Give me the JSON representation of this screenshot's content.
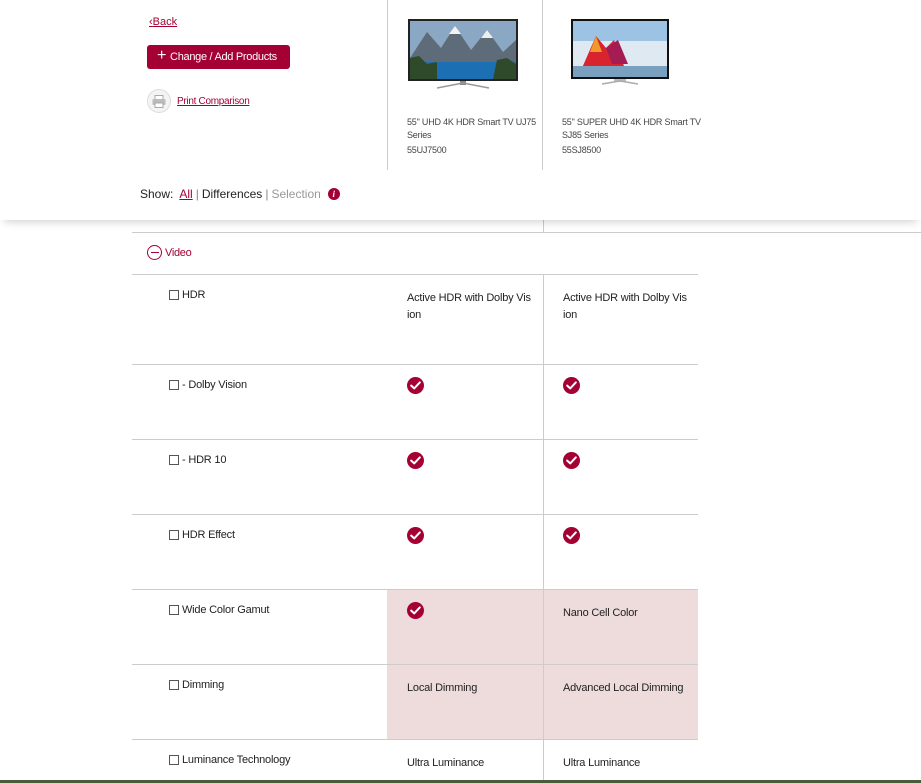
{
  "header": {
    "back_label": "Back",
    "change_label": "Change / Add Products",
    "print_label": "Print Comparison"
  },
  "products": [
    {
      "name": "55\" UHD 4K HDR Smart TV UJ75 Series",
      "model": "55UJ7500"
    },
    {
      "name": "55\" SUPER UHD 4K HDR Smart TV SJ85 Series",
      "model": "55SJ8500"
    }
  ],
  "show": {
    "label": "Show:",
    "all": "All",
    "differences": "Differences",
    "selection": "Selection",
    "separator": "|"
  },
  "section": {
    "title": "Video"
  },
  "rows": [
    {
      "label": "HDR",
      "a": {
        "type": "text",
        "text": "Active HDR with Dolby Vision"
      },
      "b": {
        "type": "text",
        "text": "Active HDR with Dolby Vision"
      },
      "highlight": false
    },
    {
      "label": "- Dolby Vision",
      "a": {
        "type": "check",
        "text": ""
      },
      "b": {
        "type": "check",
        "text": ""
      },
      "highlight": false
    },
    {
      "label": "- HDR 10",
      "a": {
        "type": "check",
        "text": ""
      },
      "b": {
        "type": "check",
        "text": ""
      },
      "highlight": false
    },
    {
      "label": "HDR Effect",
      "a": {
        "type": "check",
        "text": ""
      },
      "b": {
        "type": "check",
        "text": ""
      },
      "highlight": false
    },
    {
      "label": "Wide Color Gamut",
      "a": {
        "type": "check",
        "text": ""
      },
      "b": {
        "type": "text",
        "text": "Nano Cell Color"
      },
      "highlight": true
    },
    {
      "label": "Dimming",
      "a": {
        "type": "text",
        "text": "Local Dimming"
      },
      "b": {
        "type": "text",
        "text": "Advanced Local Dimming"
      },
      "highlight": true
    },
    {
      "label": "Luminance Technology",
      "a": {
        "type": "text",
        "text": "Ultra Luminance"
      },
      "b": {
        "type": "text",
        "text": "Ultra Luminance"
      },
      "highlight": false
    }
  ],
  "colors": {
    "accent": "#a50034",
    "highlight": "#eedcdc"
  },
  "icons": [
    "plus-icon",
    "printer-icon",
    "info-icon",
    "minus-circle-icon",
    "check-icon"
  ]
}
